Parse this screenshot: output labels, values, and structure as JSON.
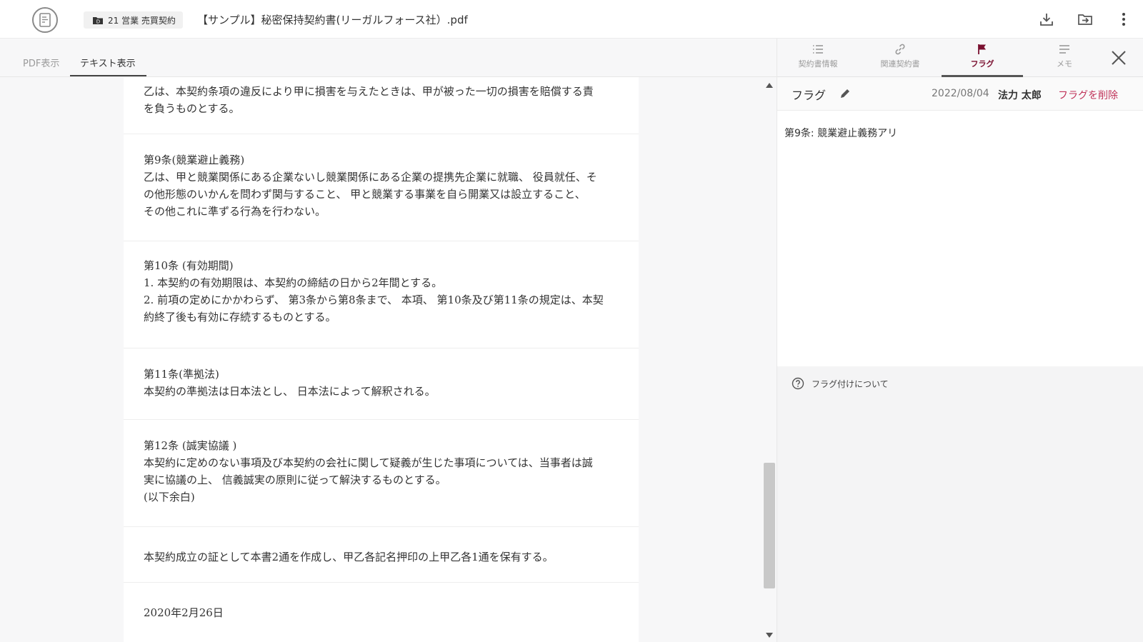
{
  "header": {
    "folder_label": "21 営業 売買契約",
    "document_title": "【サンプル】秘密保持契約書(リーガルフォース社）.pdf"
  },
  "view_tabs": [
    {
      "label": "PDF表示",
      "active": false
    },
    {
      "label": "テキスト表示",
      "active": true
    }
  ],
  "document": {
    "paragraphs": [
      {
        "lines": [
          "乙は、本契約条項の違反により甲に損害を与えたときは、甲が被った一切の損害を賠償する責",
          "を負うものとする。"
        ]
      },
      {
        "lines": [
          "第9条(競業避止義務)",
          "乙は、甲と競業関係にある企業ないし競業関係にある企業の提携先企業に就職、 役員就任、そ",
          "の他形態のいかんを問わず関与すること、 甲と競業する事業を自ら開業又は設立すること、",
          "その他これに準ずる行為を行わない。"
        ]
      },
      {
        "lines": [
          "第10条 (有効期間)",
          "1. 本契約の有効期限は、本契約の締結の日から2年間とする。",
          "2. 前項の定めにかかわらず、 第3条から第8条まで、 本項、 第10条及び第11条の規定は、本契",
          "約終了後も有効に存続するものとする。"
        ]
      },
      {
        "lines": [
          "第11条(準拠法)",
          "本契約の準拠法は日本法とし、 日本法によって解釈される。"
        ]
      },
      {
        "lines": [
          "第12条 (誠実協議 )",
          "本契約に定めのない事項及び本契約の会社に関して疑義が生じた事項については、当事者は誠",
          "実に協議の上、 信義誠実の原則に従って解決するものとする。",
          "(以下余白)"
        ]
      },
      {
        "lines": [
          "本契約成立の証として本書2通を作成し、甲乙各記名押印の上甲乙各1通を保有する。"
        ]
      },
      {
        "lines": [
          "2020年2月26日"
        ]
      }
    ]
  },
  "side_panel": {
    "tabs": [
      {
        "label": "契約書情報",
        "icon": "list-icon",
        "active": false
      },
      {
        "label": "関連契約書",
        "icon": "link-icon",
        "active": false
      },
      {
        "label": "フラグ",
        "icon": "flag-icon",
        "active": true
      },
      {
        "label": "メモ",
        "icon": "memo-icon",
        "active": false
      }
    ],
    "flag": {
      "title": "フラグ",
      "date": "2022/08/04",
      "user": "法力 太郎",
      "delete_label": "フラグを削除",
      "body": "第9条: 競業避止義務アリ"
    },
    "help_label": "フラグ付けについて"
  },
  "colors": {
    "accent_flag": "#7a1030",
    "delete_link": "#c0345a"
  }
}
